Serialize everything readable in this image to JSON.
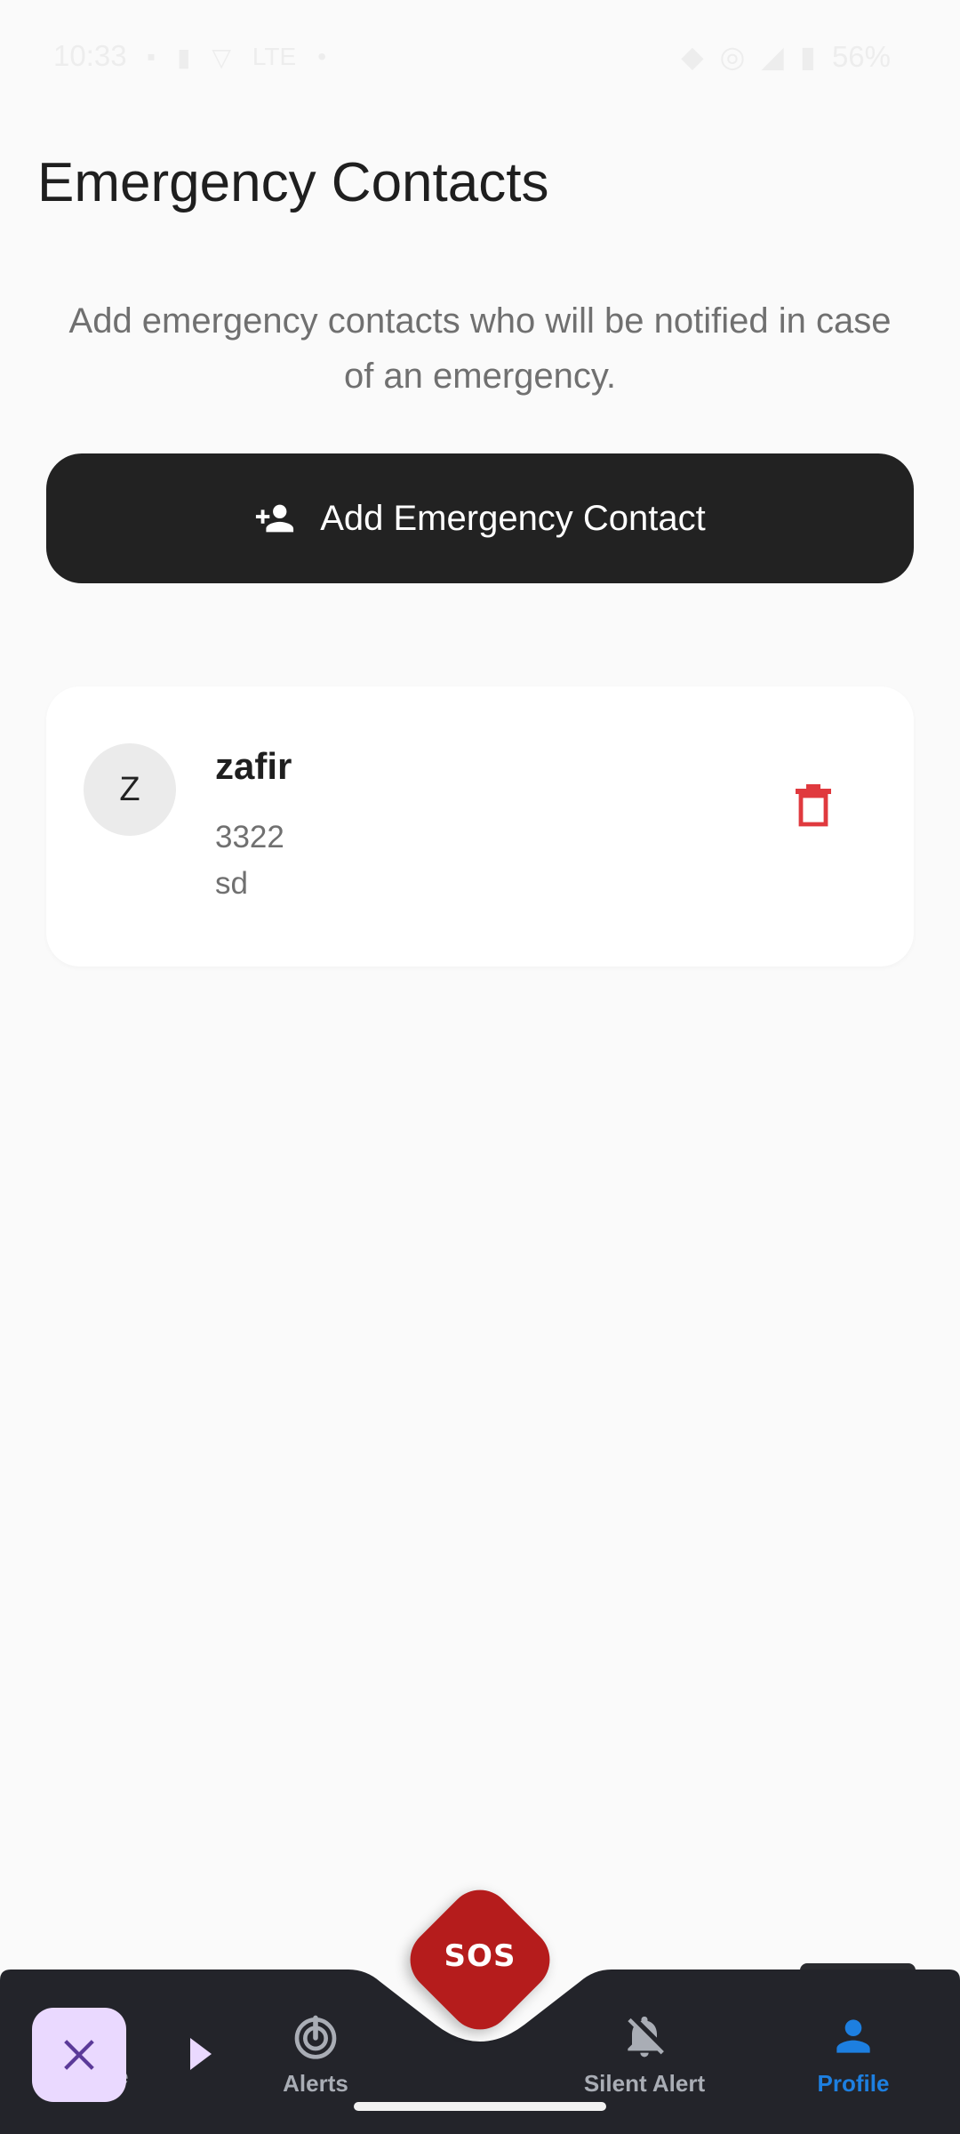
{
  "status_bar": {
    "time": "10:33",
    "carrier": "LTE",
    "battery": "56%"
  },
  "page": {
    "title": "Emergency Contacts",
    "description": "Add emergency contacts who will be notified in case of an emergency."
  },
  "add_button": {
    "label": "Add Emergency Contact",
    "icon": "person-add-icon"
  },
  "contacts": [
    {
      "initial": "Z",
      "name": "zafir",
      "phone": "3322",
      "relation": "sd",
      "delete_icon": "trash-icon"
    }
  ],
  "colors": {
    "background": "#fafafa",
    "button_bg": "#222222",
    "delete_red": "#e0393e",
    "sos_red": "#b51c1c",
    "nav_bg": "#23242a",
    "nav_active": "#1d7fe0",
    "nav_inactive": "#a9adb5",
    "overlay_bg": "#ead9ff",
    "overlay_icon": "#5b3a99"
  },
  "sos": {
    "label": "SOS"
  },
  "bottom_nav": {
    "home_partial": "e",
    "items": [
      {
        "label": "Alerts",
        "icon": "radar-alert-icon"
      },
      {
        "label": "Silent Alert",
        "icon": "bell-off-icon"
      },
      {
        "label": "Profile",
        "icon": "person-icon",
        "active": true
      }
    ]
  }
}
